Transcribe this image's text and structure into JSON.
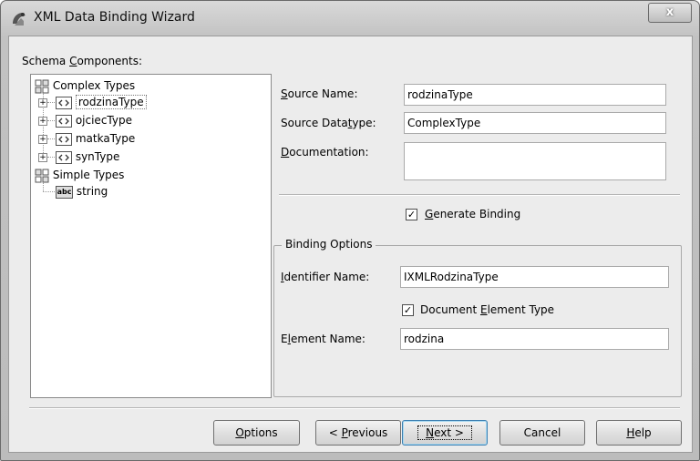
{
  "window": {
    "title": "XML Data Binding Wizard",
    "close_glyph": "x"
  },
  "tree": {
    "label_pre": "Schema ",
    "label_u": "C",
    "label_post": "omponents:",
    "items": [
      {
        "label": "Complex Types",
        "icon": "complex-types-icon"
      },
      {
        "label": "rodzinaType",
        "icon": "type-icon"
      },
      {
        "label": "ojciecType",
        "icon": "type-icon"
      },
      {
        "label": "matkaType",
        "icon": "type-icon"
      },
      {
        "label": "synType",
        "icon": "type-icon"
      },
      {
        "label": "Simple Types",
        "icon": "simple-types-icon"
      },
      {
        "label": "string",
        "icon": "abc-icon",
        "icon_text": "abc"
      }
    ]
  },
  "form": {
    "source_name": {
      "l_pre": "",
      "l_u": "S",
      "l_post": "ource Name:",
      "value": "rodzinaType"
    },
    "source_datatype": {
      "l_pre": "Source Data",
      "l_u": "t",
      "l_post": "ype:",
      "value": "ComplexType"
    },
    "documentation": {
      "l_pre": "",
      "l_u": "D",
      "l_post": "ocumentation:",
      "value": ""
    },
    "generate_binding": {
      "pre": "",
      "u": "G",
      "post": "enerate Binding",
      "checked": "✓"
    }
  },
  "binding_options": {
    "title": "Binding Options",
    "identifier": {
      "l_pre": "",
      "l_u": "I",
      "l_post": "dentifier Name:",
      "value": "IXMLRodzinaType"
    },
    "document_element": {
      "pre": "Document ",
      "u": "E",
      "post": "lement Type",
      "checked": "✓"
    },
    "element": {
      "l_pre": "E",
      "l_u": "l",
      "l_post": "ement Name:",
      "value": "rodzina"
    }
  },
  "buttons": {
    "options": {
      "pre": "",
      "u": "O",
      "post": "ptions"
    },
    "previous": {
      "pre": "< ",
      "u": "P",
      "post": "revious"
    },
    "next": {
      "pre": "",
      "u": "N",
      "post": "ext >"
    },
    "cancel": {
      "pre": "Cancel",
      "u": "",
      "post": ""
    },
    "help": {
      "pre": "",
      "u": "H",
      "post": "elp"
    }
  }
}
